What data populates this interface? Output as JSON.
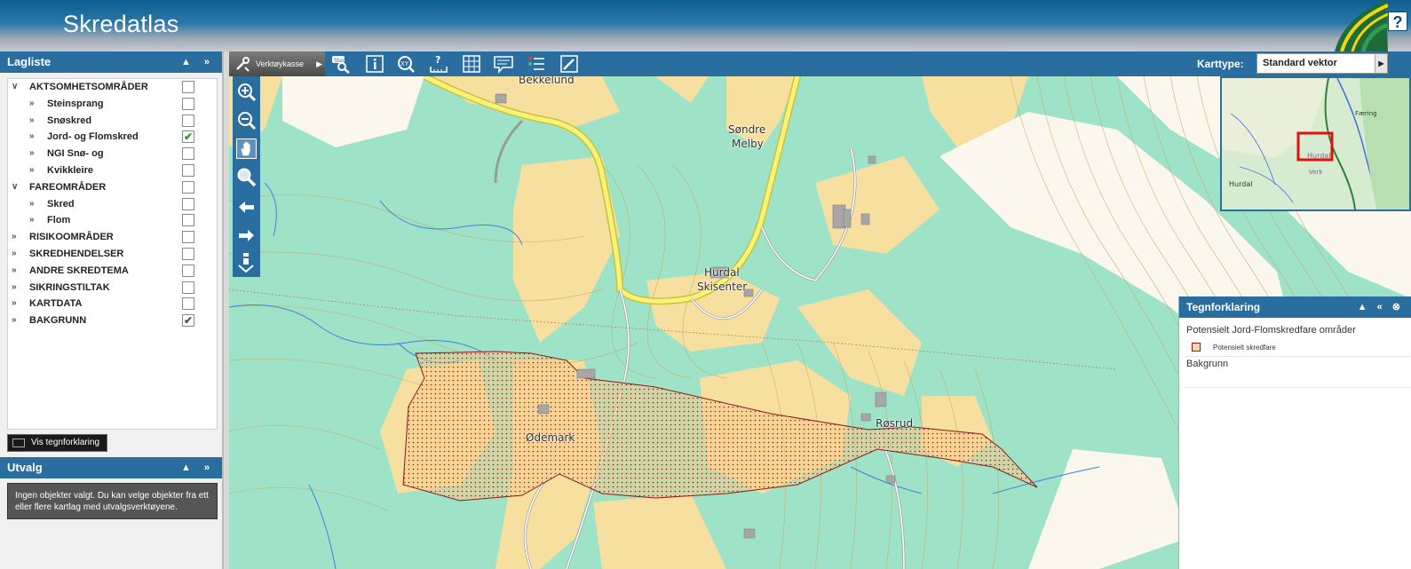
{
  "header": {
    "title": "Skredatlas",
    "help_label": "?"
  },
  "left_panel": {
    "layer_list_title": "Lagliste",
    "layers": [
      {
        "label": "AKTSOMHETSOMRÅDER",
        "level": "top",
        "chevron": "open",
        "checked": ""
      },
      {
        "label": "Steinsprang",
        "level": "sub",
        "checked": ""
      },
      {
        "label": "Snøskred",
        "level": "sub",
        "checked": ""
      },
      {
        "label": "Jord- og Flomskred",
        "level": "sub",
        "checked": "✔"
      },
      {
        "label": "NGI Snø- og",
        "level": "sub",
        "checked": ""
      },
      {
        "label": "Kvikkleire",
        "level": "sub",
        "checked": ""
      },
      {
        "label": "FAREOMRÅDER",
        "level": "top",
        "chevron": "open",
        "checked": ""
      },
      {
        "label": "Skred",
        "level": "sub",
        "checked": ""
      },
      {
        "label": "Flom",
        "level": "sub",
        "checked": ""
      },
      {
        "label": "RISIKOOMRÅDER",
        "level": "top",
        "checked": ""
      },
      {
        "label": "SKREDHENDELSER",
        "level": "top",
        "checked": ""
      },
      {
        "label": "ANDRE SKREDTEMA",
        "level": "top",
        "checked": ""
      },
      {
        "label": "SIKRINGSTILTAK",
        "level": "top",
        "checked": ""
      },
      {
        "label": "KARTDATA",
        "level": "top",
        "checked": ""
      },
      {
        "label": "BAKGRUNN",
        "level": "top",
        "checked": "✔"
      }
    ],
    "legend_button": "Vis tegnforklaring",
    "selection_title": "Utvalg",
    "selection_message": "Ingen objekter valgt. Du kan velge objekter fra ett eller flere kartlag med utvalgsverktøyene."
  },
  "toolbar": {
    "toolbox_label": "Verktøykasse",
    "tools": [
      "sted-search-icon",
      "info-icon",
      "xy-coordinate-icon",
      "measure-icon",
      "grid-icon",
      "comment-icon",
      "list-icon",
      "draw-icon"
    ],
    "karttype_label": "Karttype:",
    "karttype_value": "Standard vektor"
  },
  "nav_tools": [
    "zoom-in-icon",
    "zoom-out-icon",
    "pan-hand-icon",
    "zoom-box-icon",
    "back-arrow-icon",
    "forward-arrow-icon",
    "info-download-icon"
  ],
  "map": {
    "places": [
      {
        "name": "Bekkelund"
      },
      {
        "name": "Søndre"
      },
      {
        "name": "Melby"
      },
      {
        "name": "Hurdal"
      },
      {
        "name": "Skisenter"
      },
      {
        "name": "Ødemark"
      },
      {
        "name": "Røsrud"
      }
    ]
  },
  "overview": {
    "places": [
      "Hurdal",
      "Verk",
      "Hurdal",
      "Færing"
    ]
  },
  "legend_panel": {
    "title": "Tegnforklaring",
    "group1": "Potensielt Jord-Flomskredfare områder",
    "item1": "Potensielt skredfare",
    "group2": "Bakgrunn"
  },
  "colors": {
    "accent": "#2a6ea0",
    "map_green": "#9ee3c7",
    "map_yellow": "#f7dfa0",
    "hazard_fill": "#f5c98a",
    "hazard_border": "#8b1a1a"
  }
}
